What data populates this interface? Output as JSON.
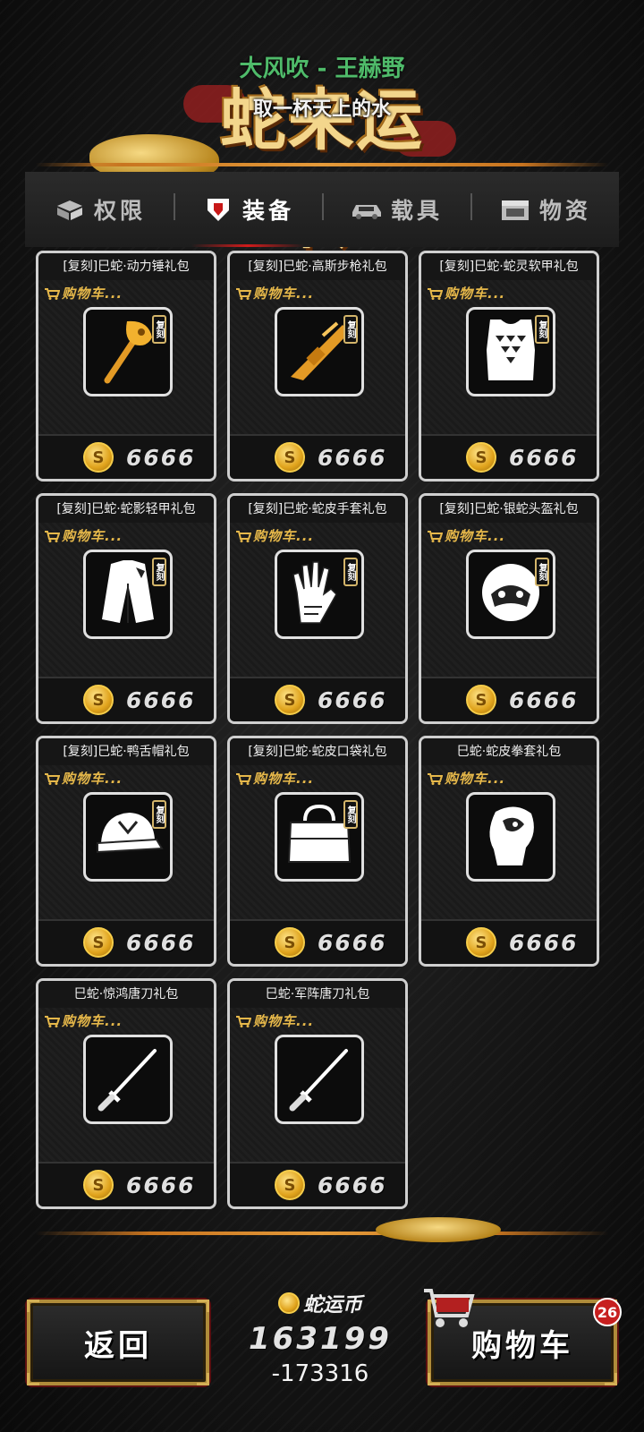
{
  "header": {
    "title": "蛇来运转",
    "song": "大风吹 - 王赫野",
    "lyric": "取一杯天上的水"
  },
  "tabs": [
    {
      "label": "权限",
      "icon": "gift-box-icon",
      "active": false
    },
    {
      "label": "装备",
      "icon": "shield-icon",
      "active": true
    },
    {
      "label": "载具",
      "icon": "car-icon",
      "active": false
    },
    {
      "label": "物资",
      "icon": "crate-icon",
      "active": false
    }
  ],
  "cart_tag": "购物车...",
  "replica_badge": "复刻",
  "coin_glyph": "S",
  "items": [
    {
      "title": "[复刻]巳蛇·动力锤礼包",
      "price": "6666",
      "icon": "hammer-icon",
      "replica": true
    },
    {
      "title": "[复刻]巳蛇·高斯步枪礼包",
      "price": "6666",
      "icon": "rifle-icon",
      "replica": true
    },
    {
      "title": "[复刻]巳蛇·蛇灵软甲礼包",
      "price": "6666",
      "icon": "vest-icon",
      "replica": true
    },
    {
      "title": "[复刻]巳蛇·蛇影轻甲礼包",
      "price": "6666",
      "icon": "jacket-icon",
      "replica": true
    },
    {
      "title": "[复刻]巳蛇·蛇皮手套礼包",
      "price": "6666",
      "icon": "gloves-icon",
      "replica": true
    },
    {
      "title": "[复刻]巳蛇·银蛇头盔礼包",
      "price": "6666",
      "icon": "helmet-icon",
      "replica": true
    },
    {
      "title": "[复刻]巳蛇·鸭舌帽礼包",
      "price": "6666",
      "icon": "cap-icon",
      "replica": true
    },
    {
      "title": "[复刻]巳蛇·蛇皮口袋礼包",
      "price": "6666",
      "icon": "bag-icon",
      "replica": true
    },
    {
      "title": "巳蛇·蛇皮拳套礼包",
      "price": "6666",
      "icon": "boxing-glove-icon",
      "replica": false
    },
    {
      "title": "巳蛇·惊鸿唐刀礼包",
      "price": "6666",
      "icon": "sword-icon",
      "replica": false
    },
    {
      "title": "巳蛇·军阵唐刀礼包",
      "price": "6666",
      "icon": "sword-icon",
      "replica": false
    }
  ],
  "footer": {
    "back_label": "返回",
    "cart_label": "购物车",
    "cart_count": "26",
    "currency_name": "蛇运币",
    "currency_amount": "163199",
    "currency_diff": "-173316"
  },
  "colors": {
    "accent_gold": "#e6b84a",
    "active_tab_underline": "#d11b1b",
    "song_green": "#4fbb6a",
    "badge_red": "#c71f1f"
  }
}
